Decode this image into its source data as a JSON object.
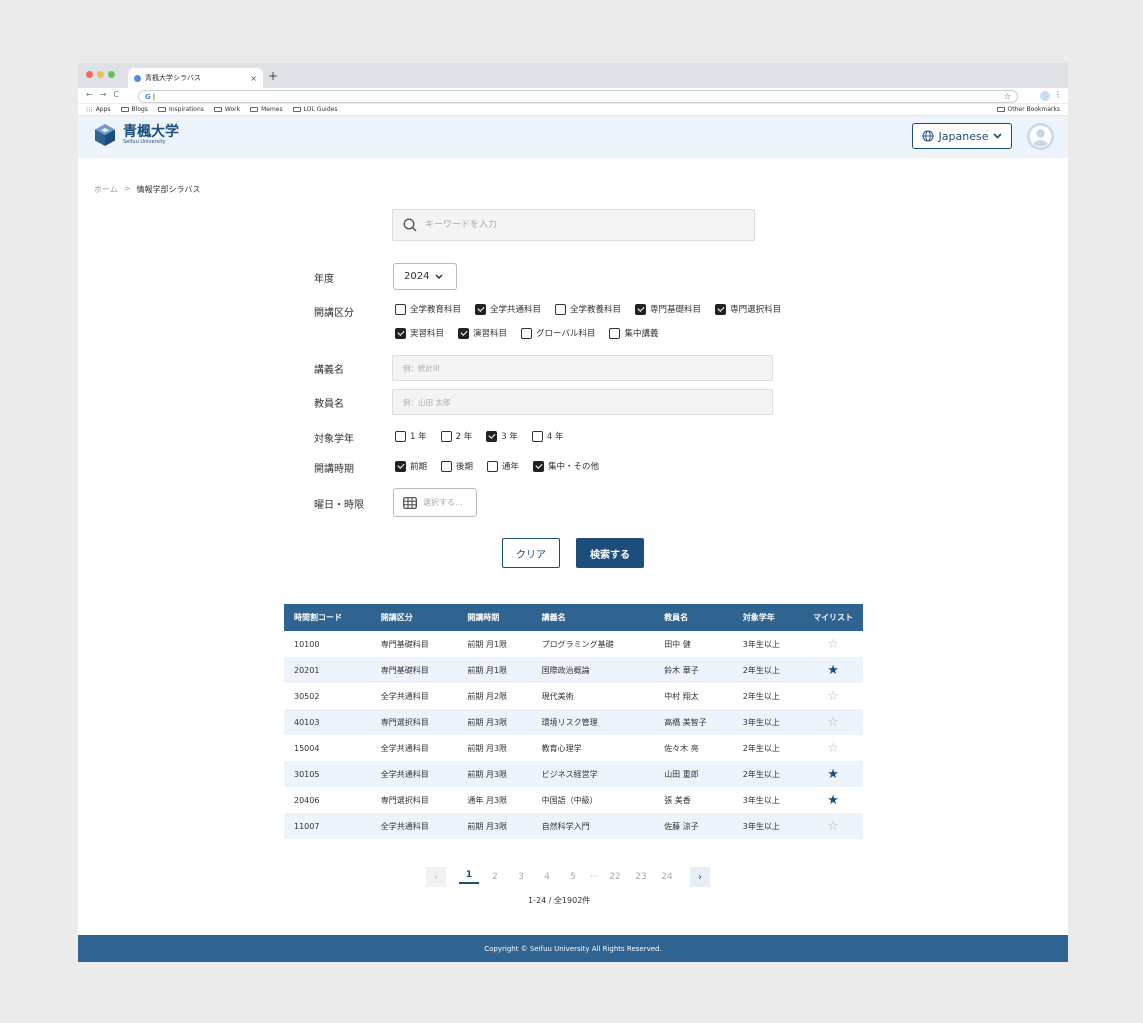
{
  "browser": {
    "tab_title": "青楓大学シラバス",
    "tab_close": "×",
    "new_tab": "+",
    "address_text": "G",
    "bookmarks": [
      "Apps",
      "Blogs",
      "Inspirations",
      "Work",
      "Memes",
      "LOL Guides"
    ],
    "other_bookmarks": "Other Bookmarks",
    "traffic_colors": [
      "#ee6a5e",
      "#f5bd4f",
      "#61c454"
    ]
  },
  "header": {
    "university_name": "青楓大学",
    "university_sub": "Seifuu University",
    "language": "Japanese",
    "brand_color": "#1d4d7a"
  },
  "breadcrumb": {
    "home": "ホーム",
    "separator": ">",
    "current": "情報学部シラバス"
  },
  "search": {
    "placeholder": "キーワードを入力"
  },
  "form": {
    "year_label": "年度",
    "year_value": "2024",
    "category_label": "開講区分",
    "categories_row1": [
      {
        "label": "全学教育科目",
        "checked": false
      },
      {
        "label": "全学共通科目",
        "checked": true
      },
      {
        "label": "全学教養科目",
        "checked": false
      },
      {
        "label": "専門基礎科目",
        "checked": true
      },
      {
        "label": "専門選択科目",
        "checked": true
      }
    ],
    "categories_row2": [
      {
        "label": "実習科目",
        "checked": true
      },
      {
        "label": "演習科目",
        "checked": true
      },
      {
        "label": "グローバル科目",
        "checked": false
      },
      {
        "label": "集中講義",
        "checked": false
      }
    ],
    "course_label": "講義名",
    "course_placeholder": "例：統計III",
    "teacher_label": "教員名",
    "teacher_placeholder": "例：山田 太郎",
    "grade_label": "対象学年",
    "grades": [
      {
        "label": "1 年",
        "checked": false
      },
      {
        "label": "2 年",
        "checked": false
      },
      {
        "label": "3 年",
        "checked": true
      },
      {
        "label": "4 年",
        "checked": false
      }
    ],
    "term_label": "開講時期",
    "terms": [
      {
        "label": "前期",
        "checked": true
      },
      {
        "label": "後期",
        "checked": false
      },
      {
        "label": "通年",
        "checked": false
      },
      {
        "label": "集中・その他",
        "checked": true
      }
    ],
    "time_label": "曜日・時限",
    "time_placeholder": "選択する...",
    "clear_button": "クリア",
    "search_button": "検索する"
  },
  "table": {
    "headers": [
      "時間割コード",
      "開講区分",
      "開講時期",
      "講義名",
      "教員名",
      "対象学年",
      "マイリスト"
    ],
    "rows": [
      {
        "code": "10100",
        "category": "専門基礎科目",
        "term": "前期 月1限",
        "name": "プログラミング基礎",
        "teacher": "田中 健",
        "grade": "3年生以上",
        "fav": false
      },
      {
        "code": "20201",
        "category": "専門基礎科目",
        "term": "前期 月1限",
        "name": "国際政治概論",
        "teacher": "鈴木 華子",
        "grade": "2年生以上",
        "fav": true
      },
      {
        "code": "30502",
        "category": "全学共通科目",
        "term": "前期 月2限",
        "name": "現代美術",
        "teacher": "中村 翔太",
        "grade": "2年生以上",
        "fav": false
      },
      {
        "code": "40103",
        "category": "専門選択科目",
        "term": "前期 月3限",
        "name": "環境リスク管理",
        "teacher": "高橋 美智子",
        "grade": "3年生以上",
        "fav": false
      },
      {
        "code": "15004",
        "category": "全学共通科目",
        "term": "前期 月3限",
        "name": "教育心理学",
        "teacher": "佐々木 亮",
        "grade": "2年生以上",
        "fav": false
      },
      {
        "code": "30105",
        "category": "全学共通科目",
        "term": "前期 月3限",
        "name": "ビジネス経営学",
        "teacher": "山田 重郎",
        "grade": "2年生以上",
        "fav": true
      },
      {
        "code": "20406",
        "category": "専門選択科目",
        "term": "通年 月3限",
        "name": "中国語（中級）",
        "teacher": "張 美香",
        "grade": "3年生以上",
        "fav": true
      },
      {
        "code": "11007",
        "category": "全学共通科目",
        "term": "前期 月3限",
        "name": "自然科学入門",
        "teacher": "佐藤 涼子",
        "grade": "3年生以上",
        "fav": false
      }
    ]
  },
  "pagination": {
    "pages": [
      "1",
      "2",
      "3",
      "4",
      "5",
      "···",
      "22",
      "23",
      "24"
    ],
    "current": "1",
    "total": "1-24 / 全1902件"
  },
  "footer": {
    "copyright": "Copyright © Seifuu University All Rights Reserved."
  }
}
